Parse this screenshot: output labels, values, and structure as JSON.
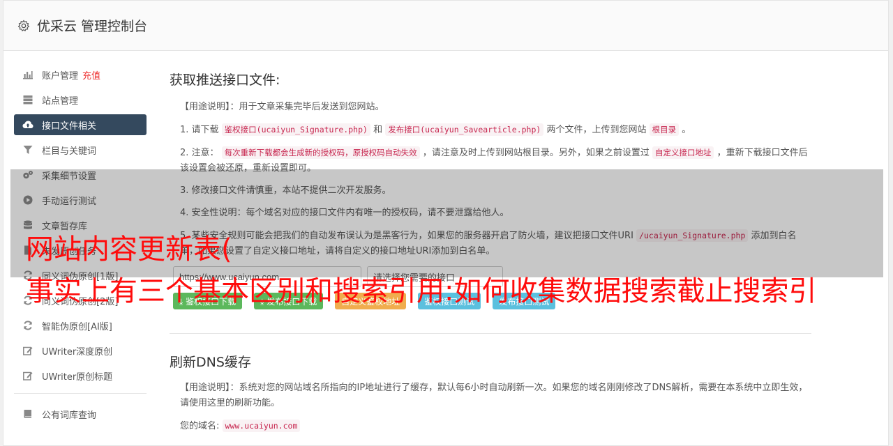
{
  "header": {
    "title": "优采云 管理控制台",
    "icon": "gear-icon"
  },
  "sidebar": {
    "items": [
      {
        "label": "账户管理",
        "extra": "充值",
        "icon": "bar-chart-icon"
      },
      {
        "label": "站点管理",
        "icon": "server-icon"
      },
      {
        "label": "接口文件相关",
        "icon": "cloud-upload-icon",
        "active": true
      },
      {
        "label": "栏目与关键词",
        "icon": "filter-icon"
      },
      {
        "label": "采集细节设置",
        "icon": "cogs-icon"
      },
      {
        "label": "手动运行测试",
        "icon": "play-circle-icon"
      },
      {
        "label": "文章暂存库",
        "icon": "database-icon"
      },
      {
        "label": "未发原创任务",
        "icon": "file-icon"
      },
      {
        "label": "同义词伪原创[1版]",
        "icon": "refresh-icon"
      },
      {
        "label": "同义词伪原创[2版]",
        "icon": "refresh-icon"
      },
      {
        "label": "智能伪原创[AI版]",
        "icon": "refresh-icon"
      },
      {
        "label": "UWriter深度原创",
        "icon": "edit-icon"
      },
      {
        "label": "UWriter原创标题",
        "icon": "edit-icon"
      },
      {
        "label": "公有词库查询",
        "icon": "book-icon"
      }
    ]
  },
  "section1": {
    "title": "获取推送接口文件:",
    "usage": "【用途说明】：用于文章采集完毕后发送到您网站。",
    "step1": {
      "a": "1. 请下载",
      "code1": "鉴权接口(ucaiyun_Signature.php)",
      "b": "和",
      "code2": "发布接口(ucaiyun_Savearticle.php)",
      "c": "两个文件，上传到您网站",
      "code3": "根目录",
      "d": "。"
    },
    "step2": {
      "a": "2. 注意：",
      "code1": "每次重新下载都会生成新的授权码，原授权码自动失效",
      "b": "，请注意及时上传到网站根目录。另外，如果之前设置过",
      "code2": "自定义接口地址",
      "c": "，重新下载接口文件后该设置会被还原，重新设置即可。"
    },
    "step3": "3. 修改接口文件请慎重，本站不提供二次开发服务。",
    "step4": "4. 安全性说明：每个域名对应的接口文件内有唯一的授权码，请不要泄露给他人。",
    "step5": {
      "a": "5. 某些安全规则可能会把我们的自动发布误认为是黑客行为，如果您的服务器开启了防火墙，建议把接口文件URI",
      "code1": "/ucaiyun_Signature.php",
      "b": "添加到白名单，如果您设置了自定义接口地址，请将自定义的接口地址URI添加到白名单。"
    },
    "url_value": "https://www.ucaiyun.com",
    "select_placeholder": "请选择您需要的接口",
    "buttons": [
      "鉴权接口下载",
      "发布接口下载",
      "自定义鉴权地址",
      "鉴权接口测试",
      "发布接口测试"
    ]
  },
  "section2": {
    "title": "刷新DNS缓存",
    "usage": "【用途说明】：系统对您的网站域名所指向的IP地址进行了缓存，默认每6小时自动刷新一次。如果您的域名刚刚修改了DNS解析，需要在本系统中立即生效，请使用这里的刷新功能。",
    "domain_label": "您的域名:",
    "domain_value": "www.ucaiyun.com"
  },
  "overlay": {
    "line1": "网站内容更新表(",
    "line2": "事实上有三个基本区别和搜索引用:如何收集数据搜索截止搜索引"
  },
  "colors": {
    "active_nav": "#34495e",
    "green": "#5cb85c",
    "orange": "#f0ad4e",
    "blue": "#5bc0de",
    "overlay_text": "#ff0c0c",
    "code": "#c7254e"
  }
}
